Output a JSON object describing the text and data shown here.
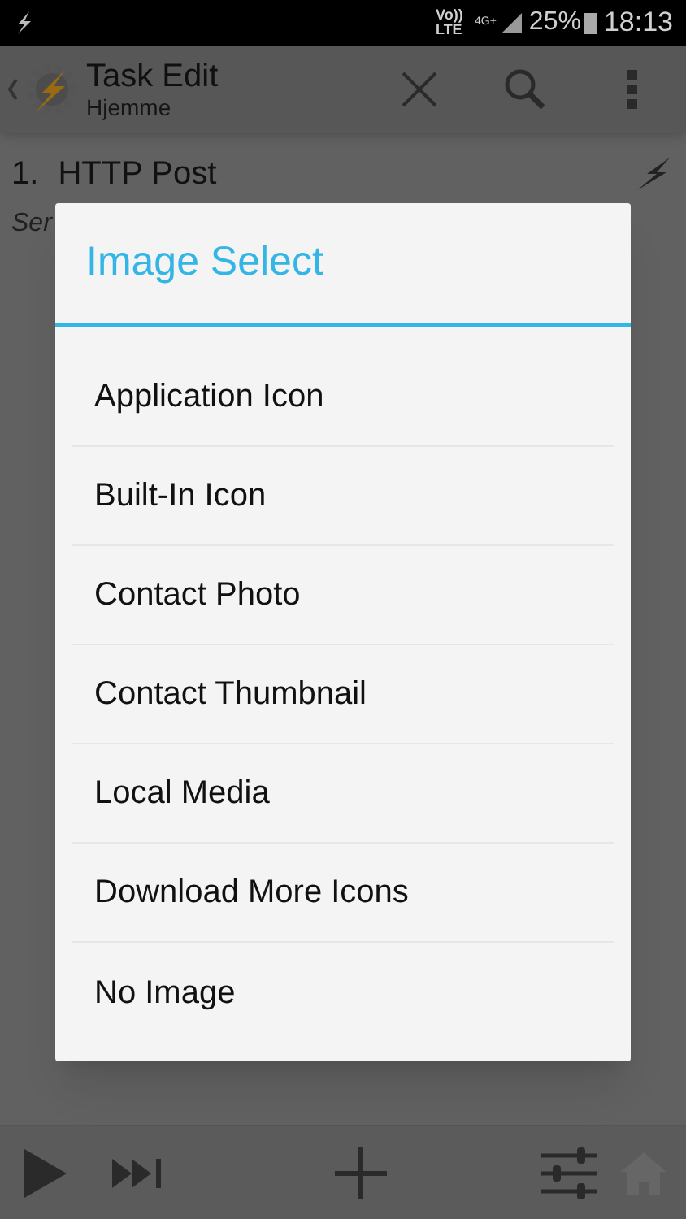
{
  "status_bar": {
    "network": "Vo)) LTE",
    "data": "4G+",
    "battery": "25%",
    "time": "18:13"
  },
  "app_bar": {
    "title": "Task Edit",
    "subtitle": "Hjemme"
  },
  "action": {
    "number": "1.",
    "name": "HTTP Post",
    "detail": "Ser"
  },
  "dialog": {
    "title": "Image Select",
    "items": [
      {
        "label": "Application Icon"
      },
      {
        "label": "Built-In Icon"
      },
      {
        "label": "Contact Photo"
      },
      {
        "label": "Contact Thumbnail"
      },
      {
        "label": "Local Media"
      },
      {
        "label": "Download More Icons"
      },
      {
        "label": "No Image"
      }
    ]
  }
}
